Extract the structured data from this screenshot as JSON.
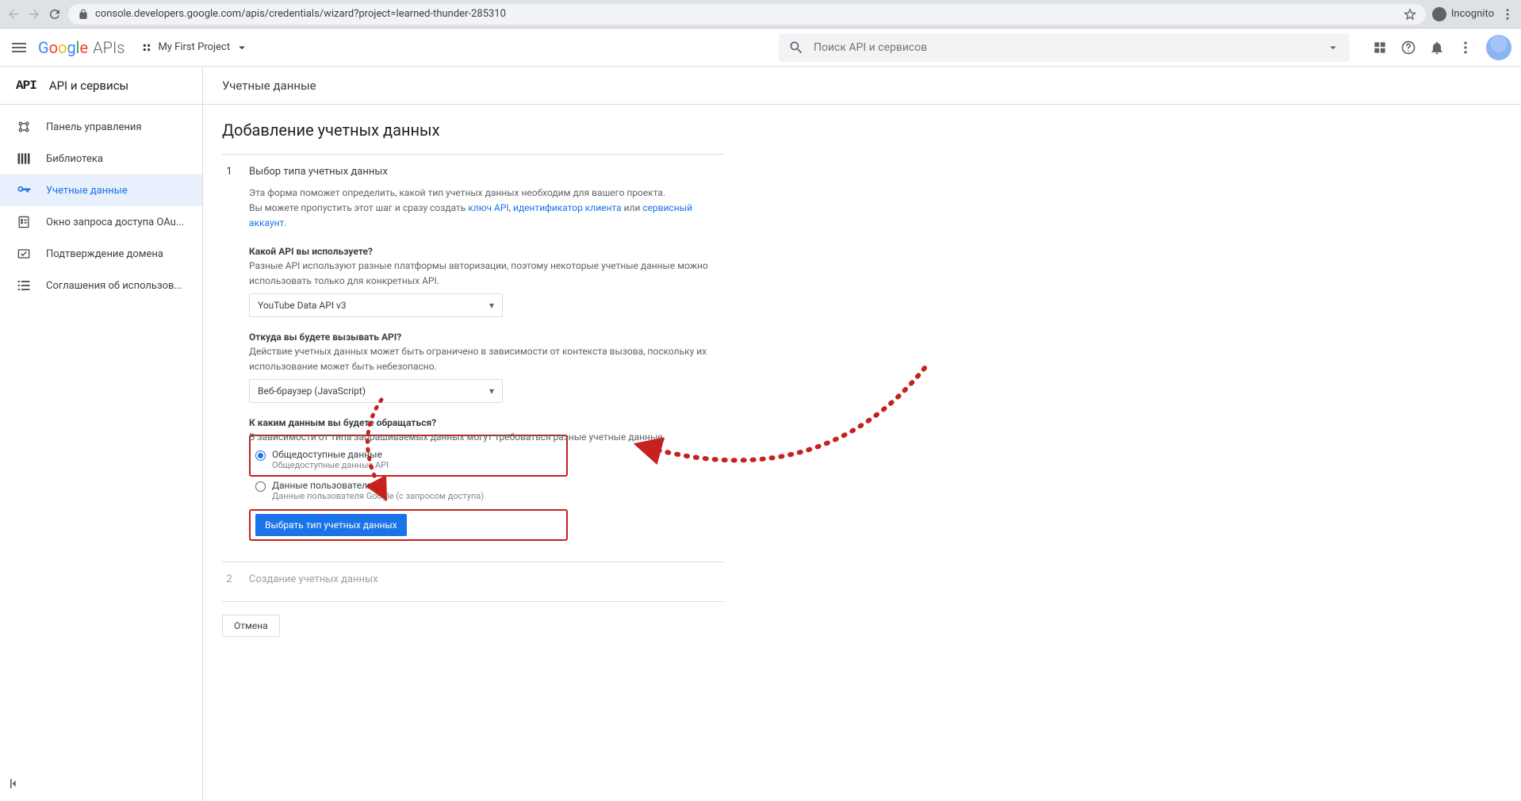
{
  "browser": {
    "url": "console.developers.google.com/apis/credentials/wizard?project=learned-thunder-285310",
    "incognito_label": "Incognito"
  },
  "header": {
    "logo_google": "Google",
    "logo_apis": "APIs",
    "project_name": "My First Project",
    "search_placeholder": "Поиск API и сервисов"
  },
  "sidebar": {
    "api_logo": "API",
    "title": "API и сервисы",
    "items": [
      {
        "label": "Панель управления"
      },
      {
        "label": "Библиотека"
      },
      {
        "label": "Учетные данные"
      },
      {
        "label": "Окно запроса доступа OAu..."
      },
      {
        "label": "Подтверждение домена"
      },
      {
        "label": "Соглашения об использов..."
      }
    ]
  },
  "main": {
    "header": "Учетные данные",
    "h1": "Добавление учетных данных",
    "step1": {
      "num": "1",
      "title": "Выбор типа учетных данных",
      "help_line1": "Эта форма поможет определить, какой тип учетных данных необходим для вашего проекта.",
      "help_line2a": "Вы можете пропустить этот шаг и сразу создать ",
      "link_api_key": "ключ API",
      "sep1": ", ",
      "link_client_id": "идентификатор клиента",
      "sep2": " или ",
      "link_service_account": "сервисный аккаунт",
      "sep3": ".",
      "q1_label": "Какой API вы используете?",
      "q1_desc": "Разные API используют разные платформы авторизации, поэтому некоторые учетные данные можно использовать только для конкретных API.",
      "q1_value": "YouTube Data API v3",
      "q2_label": "Откуда вы будете вызывать API?",
      "q2_desc": "Действие учетных данных может быть ограничено в зависимости от контекста вызова, поскольку их использование может быть небезопасно.",
      "q2_value": "Веб-браузер (JavaScript)",
      "q3_label": "К каким данным вы будете обращаться?",
      "q3_desc": "В зависимости от типа запрашиваемых данных могут требоваться разные учетные данные.",
      "radio1_label": "Общедоступные данные",
      "radio1_sub": "Общедоступные данные API",
      "radio2_label": "Данные пользователя",
      "radio2_sub": "Данные пользователя Google (с запросом доступа)",
      "submit_button": "Выбрать тип учетных данных"
    },
    "step2": {
      "num": "2",
      "title": "Создание учетных данных"
    },
    "cancel": "Отмена"
  }
}
